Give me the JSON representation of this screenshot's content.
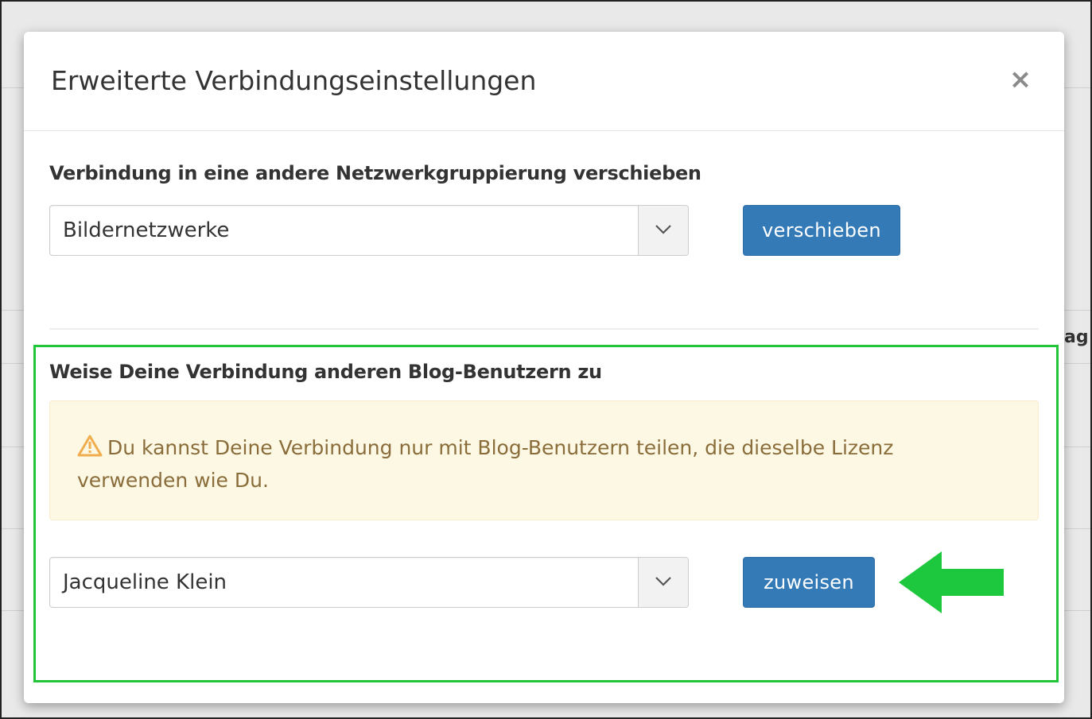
{
  "modal": {
    "title": "Erweiterte Verbindungseinstellungen",
    "close_label": "×"
  },
  "move_section": {
    "label": "Verbindung in eine andere Netzwerkgruppierung verschieben",
    "selected_value": "Bildernetzwerke",
    "button_label": "verschieben"
  },
  "assign_section": {
    "label": "Weise Deine Verbindung anderen Blog-Benutzern zu",
    "warning_text": "Du kannst Deine Verbindung nur mit Blog-Benutzern teilen, die dieselbe Lizenz verwenden wie Du.",
    "warning_icon": "warning-triangle-icon",
    "selected_user": "Jacqueline Klein",
    "button_label": "zuweisen"
  },
  "background": {
    "partial_text": "ag"
  },
  "colors": {
    "primary_button": "#337ab7",
    "highlight_border": "#22c53a",
    "warning_bg": "#fcf8e3",
    "warning_text": "#8a6d3b",
    "warning_icon": "#f0ad4e",
    "arrow": "#1ec83e"
  }
}
